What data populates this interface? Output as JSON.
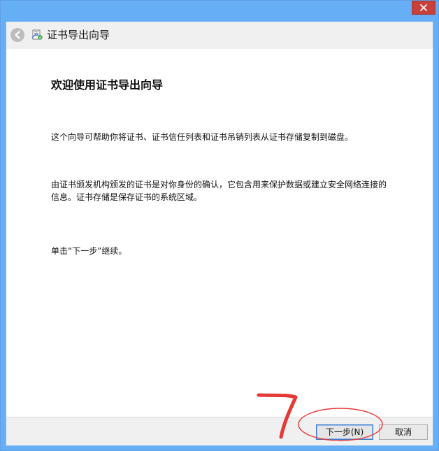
{
  "window": {
    "wizard_title": "证书导出向导"
  },
  "icons": {
    "close": "close-icon",
    "back": "back-arrow-icon",
    "wizard": "certificate-wizard-icon"
  },
  "content": {
    "heading": "欢迎使用证书导出向导",
    "paragraphs": [
      "这个向导可帮助你将证书、证书信任列表和证书吊销列表从证书存储复制到磁盘。",
      "由证书颁发机构颁发的证书是对你身份的确认，它包含用来保护数据或建立安全网络连接的信息。证书存储是保存证书的系统区域。",
      "单击“下一步”继续。"
    ]
  },
  "buttons": {
    "next": "下一步(N)",
    "cancel": "取消"
  },
  "annotation": {
    "mark": "7",
    "color": "#e53935"
  },
  "colors": {
    "window_frame": "#66aef5",
    "close_button": "#c7413b",
    "header_bg": "#f0f0f0",
    "content_bg": "#ffffff",
    "annotation_red": "#e53935"
  }
}
